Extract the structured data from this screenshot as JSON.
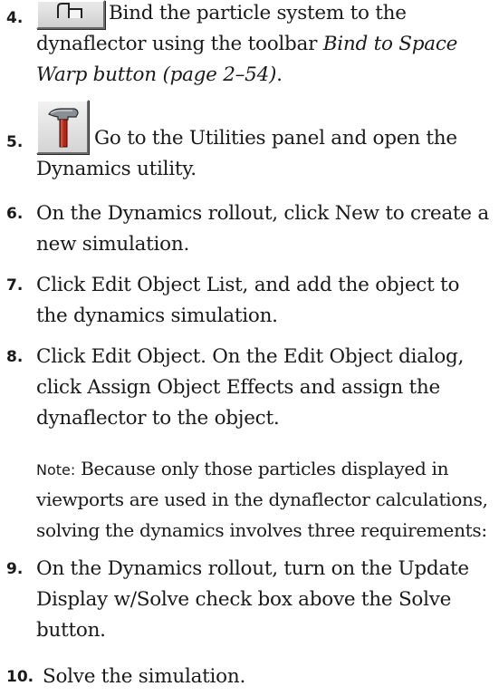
{
  "steps": [
    {
      "number": "4.",
      "text_a": "Bind the particle system to the dynaflector using the toolbar ",
      "link": "Bind to Space Warp button (page 2–54)",
      "text_b": ".",
      "icon": "bind-space-warp-icon"
    },
    {
      "number": "5.",
      "text": "Go to the Utilities panel and open the Dynamics utility.",
      "icon": "hammer-icon"
    },
    {
      "number": "6.",
      "text": "On the Dynamics rollout, click New to create a new simulation."
    },
    {
      "number": "7.",
      "text": "Click Edit Object List, and add the object to the dynamics simulation."
    },
    {
      "number": "8.",
      "text": "Click Edit Object. On the Edit Object dialog, click Assign Object Effects and assign the dynaflector to the object."
    },
    {
      "number": "9.",
      "text": "On the Dynamics rollout, turn on the Update Display w/Solve check box above the Solve button."
    },
    {
      "number": "10.",
      "text": "Solve the simulation."
    }
  ],
  "note": {
    "label": "Note:",
    "text": "Because only those particles displayed in viewports are used in the dynaflector calculations, solving the dynamics involves three requirements:"
  }
}
